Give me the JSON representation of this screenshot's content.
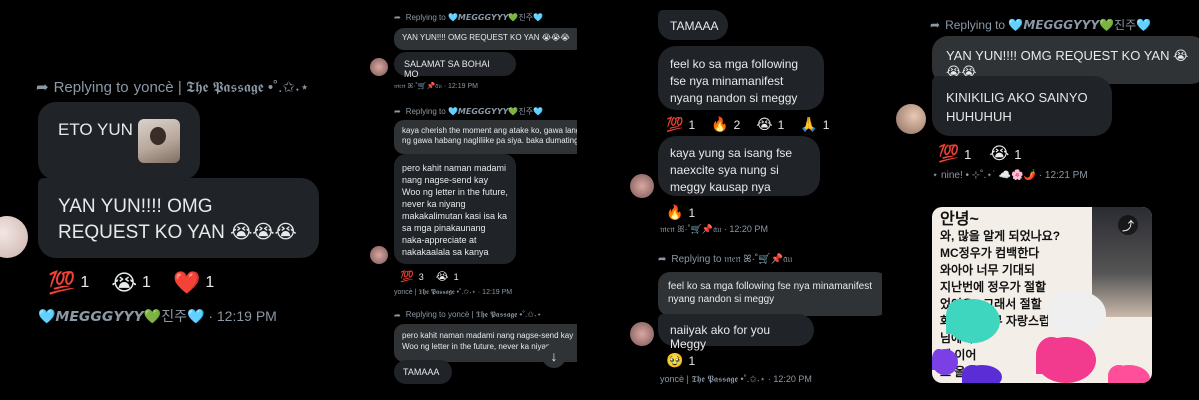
{
  "panel1": {
    "reply_prefix": "Replying to",
    "reply_name": "yoncè | 𝕿𝖍𝖊 𝕻𝖆𝖘𝖘𝖆𝖌𝖊 •˚.✩˖⋆",
    "msg1": "ETO YUN",
    "msg2": "YAN YUN!!!! OMG REQUEST KO YAN 😭😭😭",
    "reactions": [
      {
        "emoji": "💯",
        "count": "1"
      },
      {
        "emoji": "😭",
        "count": "1"
      },
      {
        "emoji": "❤️",
        "count": "1"
      }
    ],
    "sender": "🩵𝙈𝙀𝙂𝙂𝙂𝙔𝙔𝙔💚진주🩵",
    "time": "12:19 PM"
  },
  "panel2": {
    "reply1": "Replying to 🩵𝙈𝙀𝙂𝙂𝙂𝙔𝙔𝙔💚진주🩵",
    "quote1": "YAN YUN!!!! OMG REQUEST KO YAN 😭😭😭",
    "msg1": "SALAMAT SA BOHAI MO",
    "meta1": "𝔪𝔢𝔫 ꕤ·˚🛒📌𝔞𝔲 · 12:19 PM",
    "reply2": "Replying to 🩵𝙈𝙀𝙂𝙂𝙂𝙔𝙔𝙔💚진주🩵",
    "quote2": "kaya cherish the moment ang atake ko, gawa lang ng gawa habang nagliliike pa siya. baka dumating",
    "msg2": "pero kahit naman madami nang nagse-send kay Woo ng letter in the future, never ka niyang makakalimutan kasi isa ka sa mga pinakaunang naka-appreciate at nakakaalala sa kanya",
    "reactions": [
      {
        "emoji": "💯",
        "count": "3"
      },
      {
        "emoji": "😭",
        "count": "1"
      }
    ],
    "meta2": "yoncè | 𝕿𝖍𝖊 𝕻𝖆𝖘𝖘𝖆𝖌𝖊 •˚.✩˖⋆ · 12:19 PM",
    "reply3": "Replying to yoncè | 𝕿𝖍𝖊 𝕻𝖆𝖘𝖘𝖆𝖌𝖊 •˚.✩˖⋆",
    "quote3": "pero kahit naman madami nang nagse-send kay Woo ng letter in the future, never ka niyang ...",
    "msg3": "TAMAAA"
  },
  "panel3": {
    "msg_top": "TAMAAA",
    "msg1": "feel ko sa mga following fse nya minamanifest nyang nandon si meggy",
    "reactions1": [
      {
        "emoji": "💯",
        "count": "1"
      },
      {
        "emoji": "🔥",
        "count": "2"
      },
      {
        "emoji": "😭",
        "count": "1"
      },
      {
        "emoji": "🙏",
        "count": "1"
      }
    ],
    "msg2": "kaya yung sa isang fse naexcite sya nung si meggy kausap nya",
    "reactions2": [
      {
        "emoji": "🔥",
        "count": "1"
      }
    ],
    "meta1": "𝔪𝔢𝔫 ꕤ·˚🛒📌𝔞𝔲 · 12:20 PM",
    "reply": "Replying to 𝔪𝔢𝔫 ꕤ·˚🛒📌𝔞𝔲",
    "quote": "feel ko sa mga following fse nya minamanifest nyang nandon si meggy",
    "msg3": "naiiyak ako for you Meggy",
    "reactions3": [
      {
        "emoji": "🥹",
        "count": "1"
      }
    ],
    "meta2": "yoncè | 𝕿𝖍𝖊 𝕻𝖆𝖘𝖘𝖆𝖌𝖊 •˚.✩˖⋆ · 12:20 PM"
  },
  "panel4": {
    "reply": "Replying to 🩵𝙈𝙀𝙂𝙂𝙂𝙔𝙔𝙔💚진주🩵",
    "quote": "YAN YUN!!!! OMG REQUEST KO YAN 😭😭😭",
    "msg1": "KINIKILIG AKO SAINYO HUHUHUH",
    "reactions": [
      {
        "emoji": "💯",
        "count": "1"
      },
      {
        "emoji": "😭",
        "count": "1"
      }
    ],
    "meta": "⋆ nine! • ⊹˚.⋆˙ ☁️🌸🌶️ · 12:21 PM",
    "photo_lines": [
      "안녕~",
      "와, 많을 알게 되었나요?",
      "MC정우가 컴백한다",
      "와아아 너무 기대되",
      "지난번에 정우가 절할",
      "었어요 . 그래서 절할",
      "화이팅! 너무 자랑스럽다",
      "님에게",
      "께 이어",
      "스 올리고"
    ]
  }
}
